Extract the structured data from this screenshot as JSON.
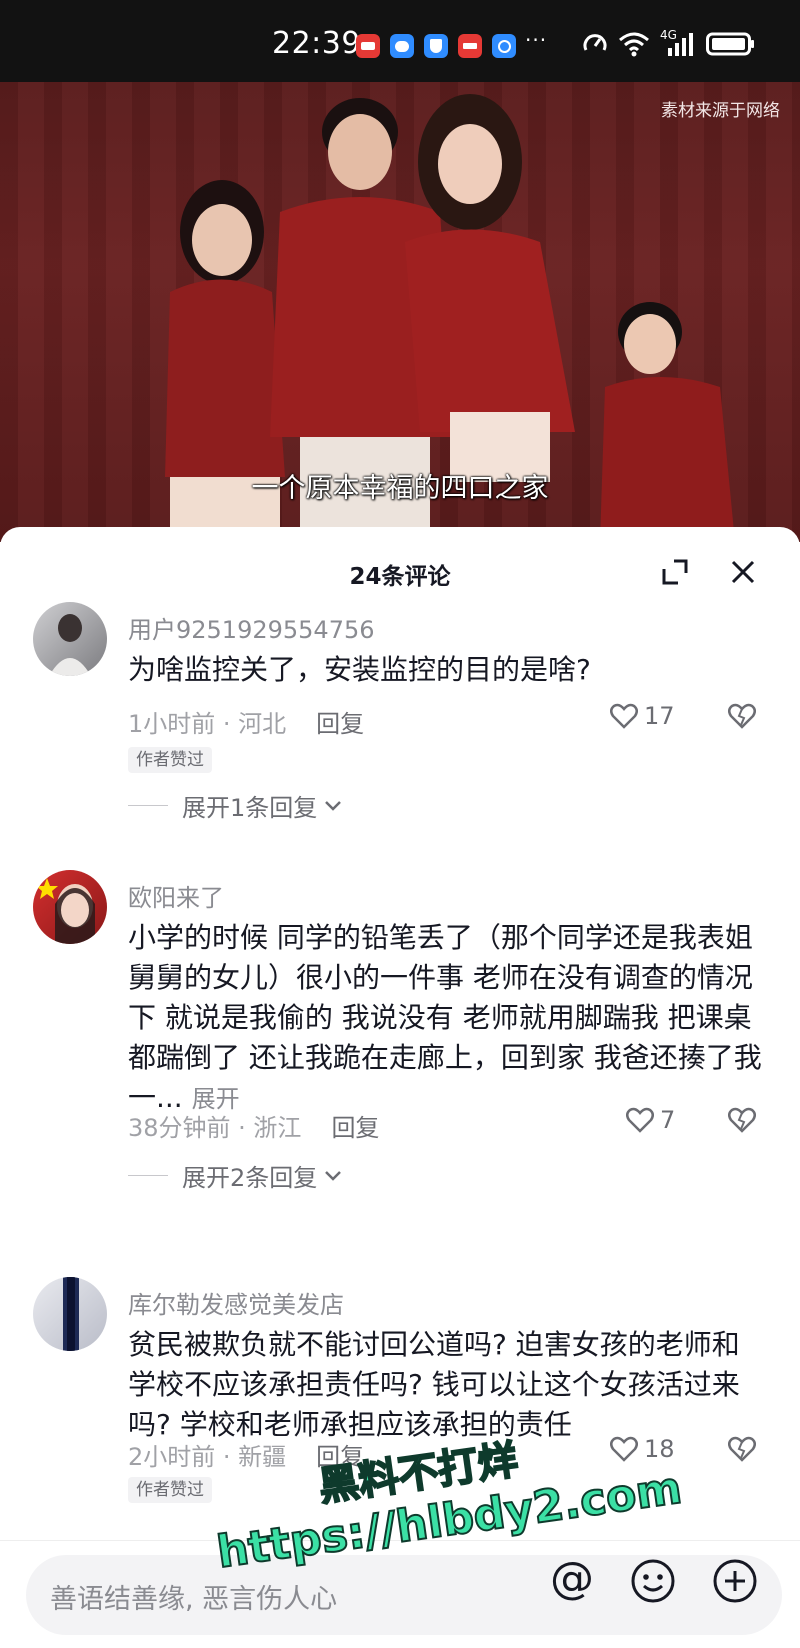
{
  "status_bar": {
    "time": "22:39",
    "notification_icons": [
      {
        "name": "shopping-app-icon",
        "color": "#e53935"
      },
      {
        "name": "message-app-icon",
        "color": "#2f8cff"
      },
      {
        "name": "shield-app-icon",
        "color": "#2f8cff"
      },
      {
        "name": "store-app-icon",
        "color": "#e53935"
      },
      {
        "name": "browser-app-icon",
        "color": "#2f8cff"
      }
    ],
    "more": "···",
    "network": "4G"
  },
  "video": {
    "source_note": "素材来源于网络",
    "caption": "一个原本幸福的四口之家"
  },
  "comments_panel": {
    "title": "24条评论",
    "comments": [
      {
        "username": "用户9251929554756",
        "text": "为啥监控关了，安装监控的目的是啥?",
        "time_location": "1小时前 · 河北",
        "reply_label": "回复",
        "likes": "17",
        "author_liked": "作者赞过",
        "expand_replies": "展开1条回复"
      },
      {
        "username": "欧阳来了",
        "text": "小学的时候 同学的铅笔丢了（那个同学还是我表姐 舅舅的女儿）很小的一件事 老师在没有调查的情况下 就说是我偷的 我说没有 老师就用脚踹我 把课桌都踹倒了 还让我跪在走廊上，回到家 我爸还揍了我一...",
        "more_label": "展开",
        "time_location": "38分钟前 · 浙江",
        "reply_label": "回复",
        "likes": "7",
        "expand_replies": "展开2条回复"
      },
      {
        "username": "库尔勒发感觉美发店",
        "text": "贫民被欺负就不能讨回公道吗? 迫害女孩的老师和学校不应该承担责任吗? 钱可以让这个女孩活过来吗? 学校和老师承担应该承担的责任",
        "time_location": "2小时前 · 新疆",
        "reply_label": "回复",
        "likes": "18",
        "author_liked": "作者赞过"
      }
    ]
  },
  "input_bar": {
    "placeholder": "善语结善缘, 恶言伤人心",
    "at_symbol": "@"
  },
  "overlay_watermark": {
    "line1": "黑料不打烊",
    "line2": "https://hlbdy2.com"
  }
}
